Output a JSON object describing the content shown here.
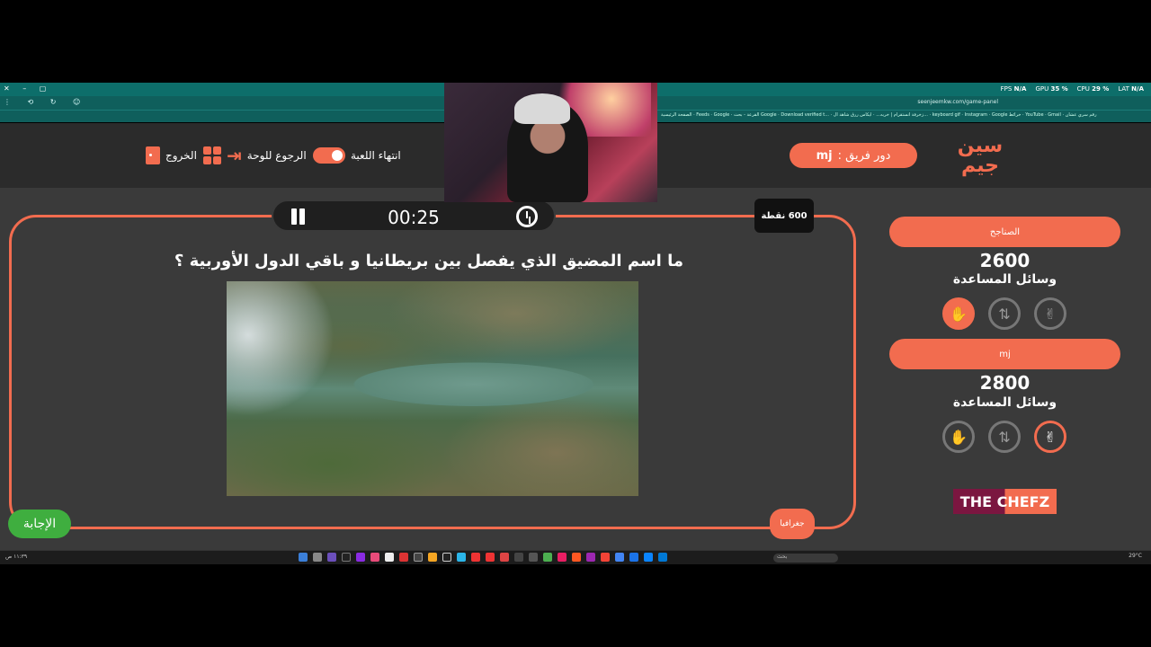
{
  "browser": {
    "window_controls": "✕ – ▢",
    "stats": {
      "fps_label": "FPS",
      "fps_value": "N/A",
      "gpu_label": "GPU",
      "gpu_value": "35 %",
      "cpu_label": "CPU",
      "cpu_value": "29 %",
      "lat_label": "LAT",
      "lat_value": "N/A"
    },
    "url": "seenjeemkw.com/game-panel",
    "bookmarks": "الصفحة الرئيسية · Feeds · Google · القرعة - بحث Google · Download verified t... · زخرفة انستقرام | خربه... · ايكاس ررق شاهد ال... · keyboard gif · Instagram · Google خرائط · YouTube · Gmail · رقم سري عشان"
  },
  "header": {
    "logo_text": "سين جيم",
    "turn_label": "دور فريق :",
    "turn_team": "mj",
    "end_game_label": "انتهاء اللعبة",
    "back_to_board_label": "الرجوع للوحة",
    "exit_label": "الخروج"
  },
  "question": {
    "timer": "00:25",
    "points": "600 نقطة",
    "text": "ما اسم المضيق الذي يفصل بين بريطانيا و باقي الدول الأوربية ؟",
    "category": "جغرافيا",
    "answer_label": "الإجابة"
  },
  "teams": [
    {
      "name": "الصناجح",
      "score": "2600",
      "aids_label": "وسائل المساعدة"
    },
    {
      "name": "mj",
      "score": "2800",
      "aids_label": "وسائل المساعدة"
    }
  ],
  "sponsor": "THE CHEFZ",
  "taskbar": {
    "search": "بحث",
    "clock": "29°C",
    "left_tray": "١١:٣٩ ص"
  },
  "colors": {
    "accent": "#f26c4f",
    "answer": "#3fae3f",
    "browser": "#0d6e6a"
  }
}
